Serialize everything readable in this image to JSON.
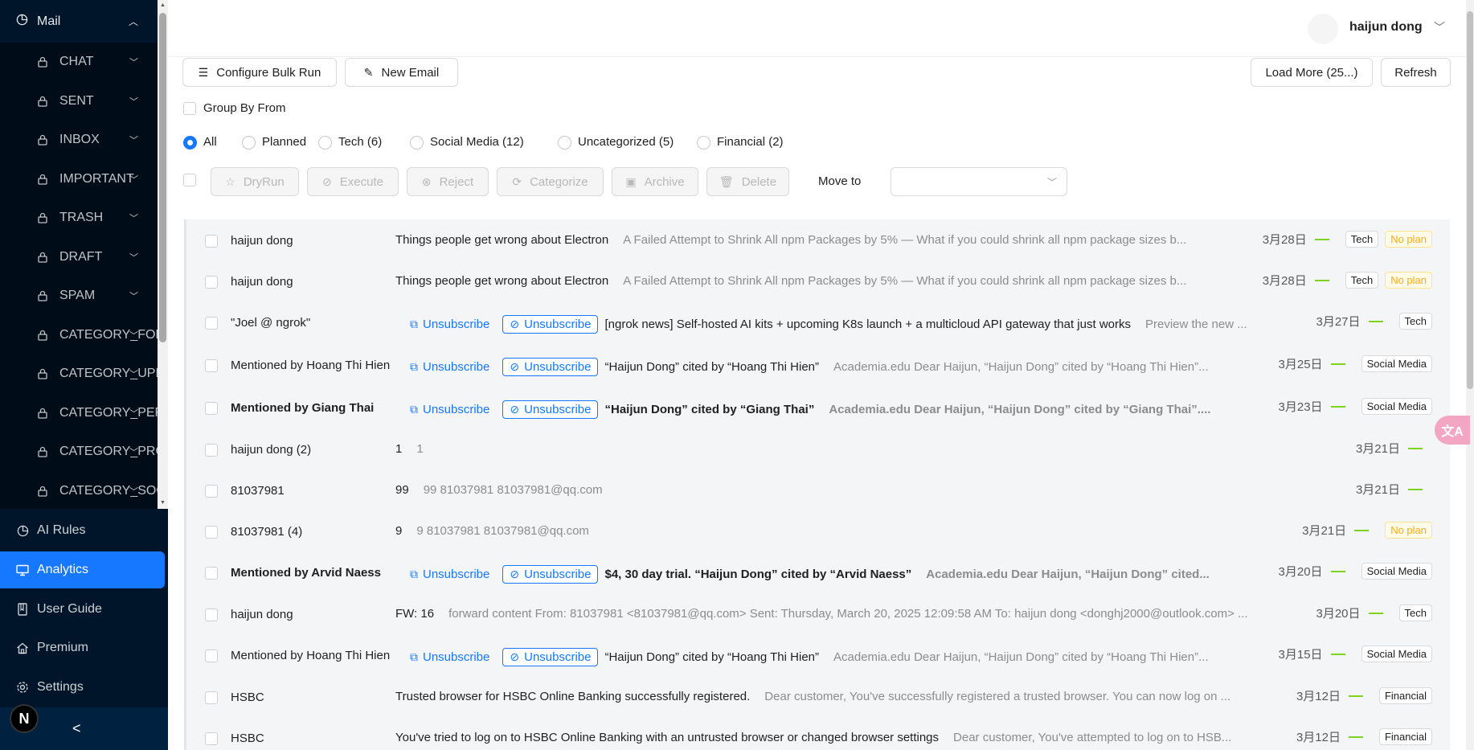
{
  "sidebar": {
    "mail_label": "Mail",
    "mail_items": [
      {
        "label": "CHAT"
      },
      {
        "label": "SENT"
      },
      {
        "label": "INBOX"
      },
      {
        "label": "IMPORTANT"
      },
      {
        "label": "TRASH"
      },
      {
        "label": "DRAFT"
      },
      {
        "label": "SPAM"
      },
      {
        "label": "CATEGORY_FORUMS"
      },
      {
        "label": "CATEGORY_UPDATES"
      },
      {
        "label": "CATEGORY_PERSONAL"
      },
      {
        "label": "CATEGORY_PROMOTIONS"
      },
      {
        "label": "CATEGORY_SOCIAL"
      }
    ],
    "nav": [
      {
        "label": "AI Rules",
        "icon": "pie-chart-icon"
      },
      {
        "label": "Analytics",
        "icon": "monitor-icon"
      },
      {
        "label": "User Guide",
        "icon": "book-icon"
      },
      {
        "label": "Premium",
        "icon": "home-icon"
      },
      {
        "label": "Settings",
        "icon": "gear-icon"
      }
    ],
    "active_nav": "Analytics",
    "logo_letter": "N",
    "collapse_glyph": "<"
  },
  "header": {
    "user_name": "haijun dong"
  },
  "toolbar": {
    "configure_label": "Configure Bulk Run",
    "new_email_label": "New Email",
    "load_more_label": "Load More (25...)",
    "refresh_label": "Refresh",
    "group_by_label": "Group By From"
  },
  "filters": {
    "selected": "All",
    "options": [
      "All",
      "Planned",
      "Tech (6)",
      "Social Media (12)",
      "Uncategorized (5)",
      "Financial (2)"
    ]
  },
  "actions": {
    "dryrun": "DryRun",
    "execute": "Execute",
    "reject": "Reject",
    "categorize": "Categorize",
    "archive": "Archive",
    "delete": "Delete",
    "move_to_label": "Move to",
    "move_to_value": ""
  },
  "unsubscribe_label": "Unsubscribe",
  "colors": {
    "accent": "#1677ff",
    "sidebar_bg": "#001529",
    "plan_dash": "#7ed321"
  },
  "emails": [
    {
      "from": "haijun dong",
      "subject": "Things people get wrong about Electron",
      "preview": "A Failed Attempt to Shrink All npm Packages by 5% — What if you could shrink all npm package sizes b...",
      "date": "3月28日",
      "tags": [
        "Tech",
        "No plan"
      ],
      "unsub": false,
      "bold": false
    },
    {
      "from": "haijun dong",
      "subject": "Things people get wrong about Electron",
      "preview": "A Failed Attempt to Shrink All npm Packages by 5% — What if you could shrink all npm package sizes b...",
      "date": "3月28日",
      "tags": [
        "Tech",
        "No plan"
      ],
      "unsub": false,
      "bold": false
    },
    {
      "from": "\"Joel @ ngrok\"",
      "subject": "[ngrok news] Self-hosted AI kits + upcoming K8s launch + a multicloud API gateway that just works",
      "preview": "Preview the new ...",
      "date": "3月27日",
      "tags": [
        "Tech"
      ],
      "unsub": true,
      "bold": false
    },
    {
      "from": "Mentioned by Hoang Thi Hien",
      "subject": "“Haijun Dong” cited by “Hoang Thi Hien”",
      "preview": "Academia.edu Dear Haijun, “Haijun Dong” cited by “Hoang Thi Hien”...",
      "date": "3月25日",
      "tags": [
        "Social Media"
      ],
      "unsub": true,
      "bold": false
    },
    {
      "from": "Mentioned by Giang Thai",
      "subject": "“Haijun Dong” cited by “Giang Thai”",
      "preview": "Academia.edu Dear Haijun, “Haijun Dong” cited by “Giang Thai”....",
      "date": "3月23日",
      "tags": [
        "Social Media"
      ],
      "unsub": true,
      "bold": true
    },
    {
      "from": "haijun dong (2)",
      "subject": "1",
      "preview": "1",
      "date": "3月21日",
      "tags": [],
      "unsub": false,
      "bold": false
    },
    {
      "from": "81037981",
      "subject": "99",
      "preview": "99 81037981 81037981@qq.com",
      "date": "3月21日",
      "tags": [],
      "unsub": false,
      "bold": false
    },
    {
      "from": "81037981 (4)",
      "subject": "9",
      "preview": "9 81037981 81037981@qq.com",
      "date": "3月21日",
      "tags": [
        "No plan"
      ],
      "unsub": false,
      "bold": false
    },
    {
      "from": "Mentioned by Arvid Naess",
      "subject": "$4, 30 day trial. “Haijun Dong” cited by “Arvid Naess”",
      "preview": "Academia.edu Dear Haijun, “Haijun Dong” cited...",
      "date": "3月20日",
      "tags": [
        "Social Media"
      ],
      "unsub": true,
      "bold": true
    },
    {
      "from": "haijun dong",
      "subject": "FW: 16",
      "preview": "forward content From: 81037981 <81037981@qq.com> Sent: Thursday, March 20, 2025 12:09:58 AM To: haijun dong <donghj2000@outlook.com> ...",
      "date": "3月20日",
      "tags": [
        "Tech"
      ],
      "unsub": false,
      "bold": false
    },
    {
      "from": "Mentioned by Hoang Thi Hien",
      "subject": "“Haijun Dong” cited by “Hoang Thi Hien”",
      "preview": "Academia.edu Dear Haijun, “Haijun Dong” cited by “Hoang Thi Hien”...",
      "date": "3月15日",
      "tags": [
        "Social Media"
      ],
      "unsub": true,
      "bold": false
    },
    {
      "from": "HSBC",
      "subject": "Trusted browser for HSBC Online Banking successfully registered.",
      "preview": "Dear customer, You've successfully registered a trusted browser. You can now log on ...",
      "date": "3月12日",
      "tags": [
        "Financial"
      ],
      "unsub": false,
      "bold": false
    },
    {
      "from": "HSBC",
      "subject": "You've tried to log on to HSBC Online Banking with an untrusted browser or changed browser settings",
      "preview": "Dear customer, You've attempted to log on to HSB...",
      "date": "3月12日",
      "tags": [
        "Financial"
      ],
      "unsub": false,
      "bold": false
    }
  ]
}
